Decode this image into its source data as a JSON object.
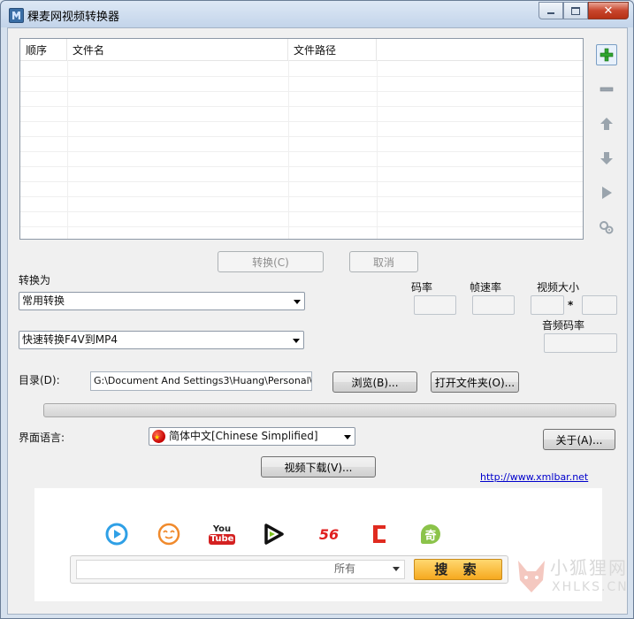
{
  "window": {
    "title": "稞麦网视频转换器"
  },
  "file_list": {
    "columns": [
      "顺序",
      "文件名",
      "文件路径",
      ""
    ],
    "rows": []
  },
  "side_buttons": [
    "add-icon",
    "remove-icon",
    "move-up-icon",
    "move-down-icon",
    "play-icon",
    "settings-icon"
  ],
  "actions": {
    "convert": "转换(C)",
    "cancel": "取消"
  },
  "convert_to": {
    "label": "转换为",
    "category": "常用转换",
    "format": "快速转换F4V到MP4"
  },
  "params": {
    "bitrate": "码率",
    "framerate": "帧速率",
    "video_size": "视频大小",
    "size_sep": "*",
    "audio_bitrate": "音频码率"
  },
  "directory": {
    "label": "目录(D):",
    "value": "G:\\Document And Settings3\\Huang\\Personal\\",
    "browse": "浏览(B)...",
    "open_folder": "打开文件夹(O)..."
  },
  "progress": {
    "value": 0
  },
  "language": {
    "label": "界面语言:",
    "value": "简体中文[Chinese Simplified]",
    "about": "关于(A)..."
  },
  "video_download": "视频下载(V)...",
  "site_link": "http://www.xmlbar.net",
  "panel": {
    "sites": [
      {
        "name": "youku-icon"
      },
      {
        "name": "tudou-icon"
      },
      {
        "name": "youtube-icon",
        "text_top": "You",
        "text_bottom": "Tube"
      },
      {
        "name": "iqiyi-play-icon"
      },
      {
        "name": "56-icon",
        "text": "56"
      },
      {
        "name": "letv-icon"
      },
      {
        "name": "qiyi-icon",
        "text": "奇"
      }
    ],
    "search_scope": "所有",
    "search_button": "搜 索"
  },
  "watermark": {
    "line1": "小狐狸网",
    "line2": "XHLKS.CN"
  },
  "colors": {
    "accent": "#f6a91f",
    "link": "#0000cc",
    "add_green": "#2fa52f"
  }
}
